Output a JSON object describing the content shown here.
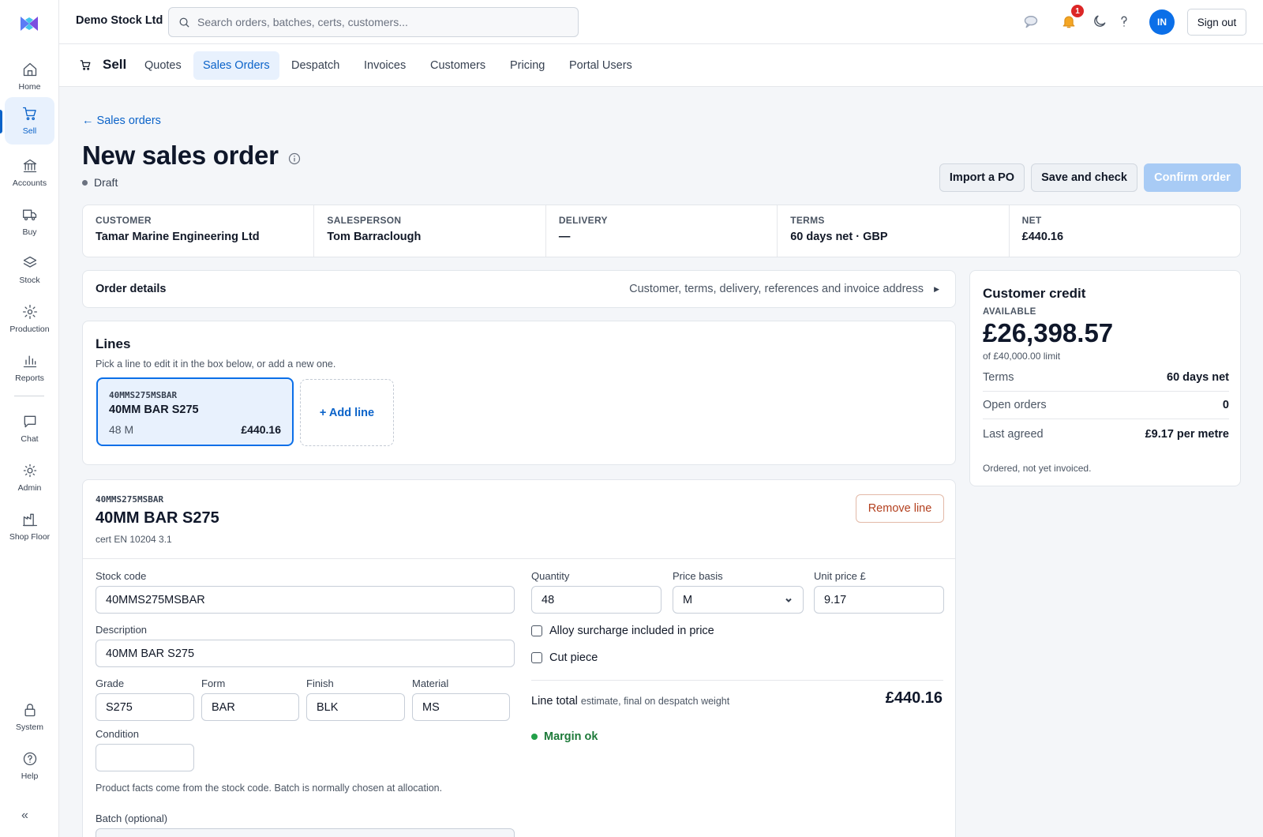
{
  "app": {
    "company": "Demo Stock Ltd",
    "search_placeholder": "Search orders, batches, certs, customers...",
    "notifications_count": "1",
    "avatar_initials": "IN",
    "sign_out": "Sign out",
    "accent": "#0b6fe8"
  },
  "sidebar": {
    "items": [
      {
        "label": "Home",
        "icon": "home-icon"
      },
      {
        "label": "Sell",
        "icon": "cart-icon",
        "active": true
      },
      {
        "label": "Accounts",
        "icon": "bank-icon"
      },
      {
        "label": "Buy",
        "icon": "truck-icon"
      },
      {
        "label": "Stock",
        "icon": "layers-icon"
      },
      {
        "label": "Production",
        "icon": "gear-icon"
      },
      {
        "label": "Reports",
        "icon": "bar-chart-icon"
      },
      {
        "label": "Chat",
        "icon": "chat-icon"
      },
      {
        "label": "Admin",
        "icon": "sun-icon"
      },
      {
        "label": "Shop Floor",
        "icon": "factory-icon"
      },
      {
        "label": "System",
        "icon": "lock-icon"
      },
      {
        "label": "Help",
        "icon": "help-icon"
      }
    ],
    "collapse": "«"
  },
  "subnav": {
    "section": "Sell",
    "tabs": [
      "Quotes",
      "Sales Orders",
      "Despatch",
      "Invoices",
      "Customers",
      "Pricing",
      "Portal Users"
    ],
    "active_tab": "Sales Orders"
  },
  "page": {
    "back_link": "← Sales orders",
    "title": "New sales order",
    "status": "Draft",
    "actions": {
      "import": "Import a PO",
      "save": "Save and check",
      "confirm": "Confirm order"
    }
  },
  "summary": [
    {
      "label": "CUSTOMER",
      "value": "Tamar Marine Engineering Ltd"
    },
    {
      "label": "SALESPERSON",
      "value": "Tom Barraclough"
    },
    {
      "label": "DELIVERY",
      "value": "—"
    },
    {
      "label": "TERMS",
      "value": "60 days net · GBP"
    },
    {
      "label": "NET",
      "value": "£440.16"
    }
  ],
  "order_details": {
    "title": "Order details",
    "description": "Customer, terms, delivery, references and invoice address"
  },
  "lines": {
    "title": "Lines",
    "subtitle": "Pick a line to edit it in the box below, or add a new one.",
    "items": [
      {
        "code": "40MMS275MSBAR",
        "name": "40MM BAR S275",
        "qty": "48 M",
        "amount": "£440.16"
      }
    ],
    "add_label": "+ Add line"
  },
  "credit": {
    "title": "Customer credit",
    "available_label": "AVAILABLE",
    "available": "£26,398.57",
    "limit": "of £40,000.00 limit",
    "rows": [
      {
        "k": "Terms",
        "v": "60 days net"
      },
      {
        "k": "Open orders",
        "v": "0"
      },
      {
        "k": "Last agreed",
        "v": "£9.17 per metre"
      }
    ],
    "note": "Ordered, not yet invoiced."
  },
  "editor": {
    "code": "40MMS275MSBAR",
    "name": "40MM BAR S275",
    "cert": "cert EN 10204 3.1",
    "remove": "Remove line",
    "fields": {
      "stock_code": {
        "label": "Stock code",
        "value": "40MMS275MSBAR"
      },
      "description": {
        "label": "Description",
        "value": "40MM BAR S275"
      },
      "grade": {
        "label": "Grade",
        "value": "S275"
      },
      "form": {
        "label": "Form",
        "value": "BAR"
      },
      "finish": {
        "label": "Finish",
        "value": "BLK"
      },
      "material": {
        "label": "Material",
        "value": "MS"
      },
      "condition": {
        "label": "Condition",
        "value": ""
      },
      "quantity": {
        "label": "Quantity",
        "value": "48"
      },
      "price_basis": {
        "label": "Price basis",
        "value": "M"
      },
      "unit_price": {
        "label": "Unit price £",
        "value": "9.17"
      },
      "batch": {
        "label": "Batch (optional)"
      }
    },
    "alloy_label": "Alloy surcharge included in price",
    "cut_label": "Cut piece",
    "facts_hint": "Product facts come from the stock code. Batch is normally chosen at allocation.",
    "line_total_label": "Line total",
    "line_total_note": "estimate, final on despatch weight",
    "line_total": "£440.16",
    "margin": "Margin ok"
  }
}
